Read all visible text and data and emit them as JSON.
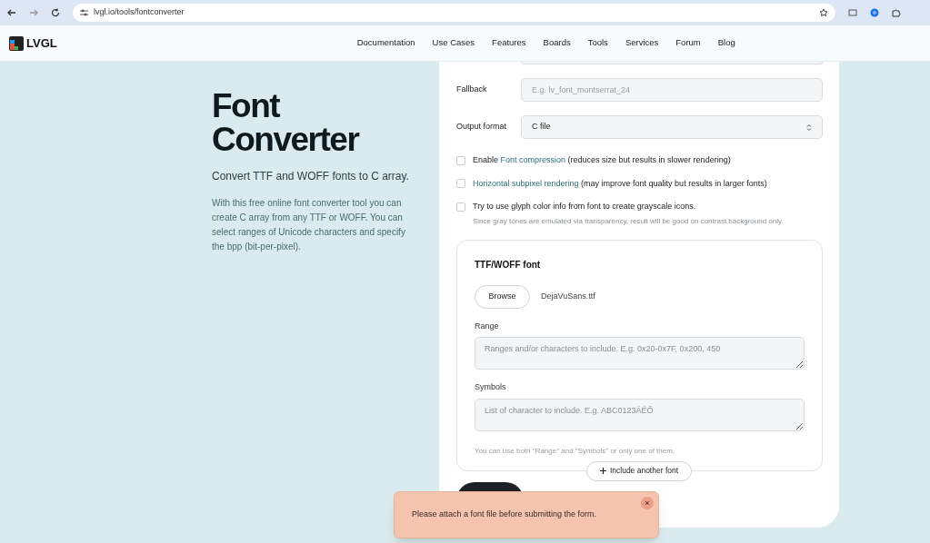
{
  "browser": {
    "url": "lvgl.io/tools/fontconverter"
  },
  "nav": {
    "logo": "LVGL",
    "items": [
      "Documentation",
      "Use Cases",
      "Features",
      "Boards",
      "Tools",
      "Services",
      "Forum",
      "Blog"
    ]
  },
  "intro": {
    "title": "Font Converter",
    "subtitle": "Convert TTF and WOFF fonts to C array.",
    "description": "With this free online font converter tool you can create C array from any TTF or WOFF. You can select ranges of Unicode characters and specify the bpp (bit-per-pixel)."
  },
  "form": {
    "fields": [
      {
        "label": "Fallback",
        "kind": "input",
        "placeholder": "E.g. lv_font_montserrat_24"
      },
      {
        "label": "Output format",
        "kind": "select",
        "value": "C file"
      }
    ],
    "options": [
      {
        "checked": false,
        "parts": [
          {
            "text": "Enable "
          },
          {
            "text": "Font compression",
            "kind": "link"
          },
          {
            "text": " (reduces size but results in slower rendering)"
          }
        ]
      },
      {
        "checked": false,
        "parts": [
          {
            "text": "Horizontal subpixel rendering",
            "kind": "link"
          },
          {
            "text": " (may improve font quality but results in larger fonts)"
          }
        ]
      },
      {
        "checked": false,
        "parts": [
          {
            "text": "Try to use glyph color info from font to create grayscale icons."
          }
        ],
        "hint": "Since gray tones are emulated via transparency, result will be good on contrast background only."
      }
    ],
    "font_card": {
      "title": "TTF/WOFF font",
      "browse": "Browse",
      "file": "DejaVuSans.ttf",
      "range": {
        "label": "Range",
        "placeholder": "Ranges and/or characters to include. E.g. 0x20-0x7F, 0x200, 450"
      },
      "symbols": {
        "label": "Symbols",
        "placeholder": "List of character to include. E.g. ABC0123ÁÉŐ"
      },
      "note": "You can use both \"Range\" and \"Symbols\" or only one of them.",
      "add": "Include another font"
    }
  },
  "toast": {
    "message": "Please attach a font file before submitting the form.",
    "close": "×"
  }
}
